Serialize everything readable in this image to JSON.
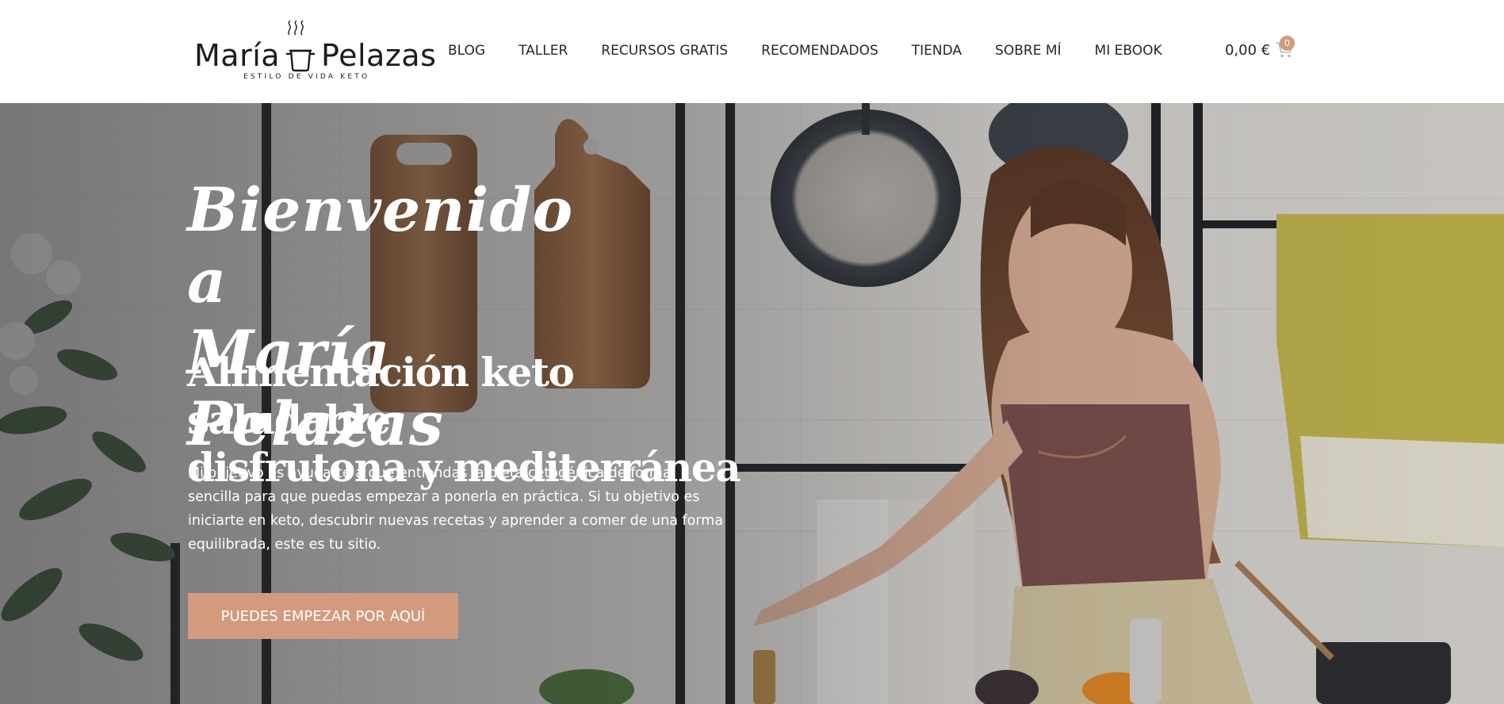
{
  "brand": {
    "name_left": "María",
    "name_right": "Pelazas",
    "tagline": "ESTILO DE VIDA KETO",
    "logo_icon": "pot-icon"
  },
  "nav": {
    "items": [
      {
        "label": "BLOG"
      },
      {
        "label": "TALLER"
      },
      {
        "label": "RECURSOS GRATIS"
      },
      {
        "label": "RECOMENDADOS"
      },
      {
        "label": "TIENDA"
      },
      {
        "label": "SOBRE MÍ"
      },
      {
        "label": "MI EBOOK"
      }
    ]
  },
  "cart": {
    "total": "0,00 €",
    "count": "0",
    "icon": "cart-icon"
  },
  "hero": {
    "title_line1": "Bienvenido a",
    "title_line2": "María Pelazas",
    "subtitle_line1": "Alimentación keto saludable,",
    "subtitle_line2": "disfrutona y mediterránea",
    "body": "Mi objetivo es ayudarte a que entiendas la dieta cetogénica de forma sencilla para que puedas empezar a ponerla en práctica. Si tu objetivo es iniciarte en keto, descubrir nuevas recetas y aprender a comer de una forma equilibrada, este es tu sitio.",
    "cta_label": "PUEDES EMPEZAR POR AQUÍ"
  },
  "colors": {
    "accent": "#d49a7d",
    "text_dark": "#262626",
    "white": "#ffffff"
  }
}
